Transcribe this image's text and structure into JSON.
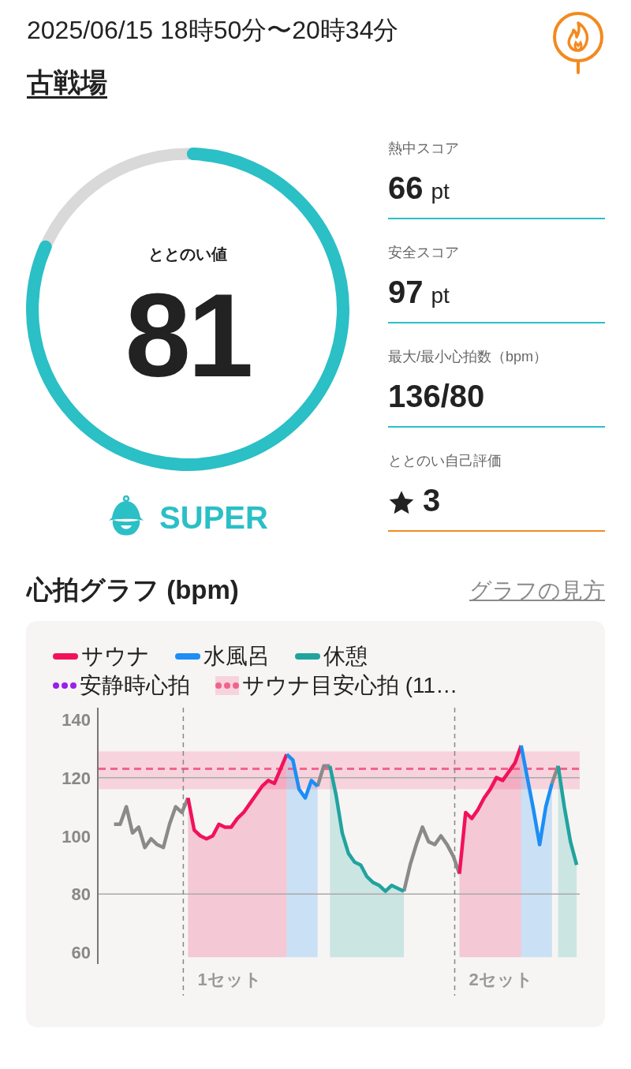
{
  "header": {
    "datetime": "2025/06/15 18時50分〜20時34分",
    "place": "古戦場"
  },
  "score": {
    "label": "ととのい値",
    "value": "81",
    "rank": "SUPER"
  },
  "stats": [
    {
      "label": "熱中スコア",
      "value": "66",
      "unit": "pt",
      "kind": "score",
      "color": "#2bbfc6"
    },
    {
      "label": "安全スコア",
      "value": "97",
      "unit": "pt",
      "kind": "score",
      "color": "#2bbfc6"
    },
    {
      "label": "最大/最小心拍数（bpm）",
      "value": "136/80",
      "kind": "plain",
      "color": "#2bbfc6"
    },
    {
      "label": "ととのい自己評価",
      "value": "3",
      "kind": "rating",
      "color": "#f28a20"
    }
  ],
  "graph": {
    "title": "心拍グラフ (bpm)",
    "help_link": "グラフの見方",
    "legend_extra": [
      {
        "label": "安静時心拍",
        "kind": "dots",
        "color": "#9b1fe8"
      },
      {
        "label": "サウナ目安心拍 (11…",
        "kind": "dots-band",
        "color": "#f0648c"
      }
    ],
    "sets": [
      {
        "label": "1セット"
      },
      {
        "label": "2セット"
      }
    ],
    "chart_data": {
      "type": "line",
      "ylim": [
        56,
        144
      ],
      "yticks": [
        60,
        80,
        100,
        120,
        140
      ],
      "grid": true,
      "ref_lines": [
        {
          "axis": "y",
          "value": 123,
          "color": "#f0648c"
        }
      ],
      "bands": [
        {
          "axis": "y",
          "from": 116,
          "to": 129,
          "color": "#f7d3dd"
        }
      ],
      "categories": [
        null,
        null,
        null,
        null,
        null,
        null,
        null,
        null,
        null,
        null,
        null,
        null,
        null,
        null,
        null,
        null,
        null,
        null,
        null,
        null,
        null,
        null,
        null,
        null,
        null,
        null,
        null,
        null,
        null,
        null,
        null,
        null,
        null,
        null,
        null,
        null,
        null,
        null,
        null,
        null,
        null,
        null,
        null,
        null,
        null,
        null,
        null,
        null,
        null,
        null,
        null,
        null,
        null,
        null,
        null,
        null,
        null,
        null,
        null,
        null,
        null,
        null,
        null,
        null,
        null,
        null,
        null,
        null,
        null,
        null,
        null,
        null,
        null,
        null,
        null,
        null,
        null,
        null
      ],
      "series": [
        {
          "color": "#8a8a8a",
          "values": [
            null,
            null,
            104,
            104,
            110,
            101,
            103,
            96,
            99,
            97,
            96,
            104,
            110,
            108,
            113,
            null,
            null,
            null,
            null,
            null,
            null,
            null,
            null,
            null,
            null,
            null,
            null,
            null,
            null,
            null,
            null,
            null,
            null,
            null,
            null,
            117,
            124,
            124,
            null,
            null,
            null,
            null,
            null,
            null,
            null,
            null,
            null,
            null,
            null,
            81,
            90,
            97,
            103,
            98,
            97,
            100,
            97,
            93,
            87,
            null,
            null,
            null,
            null,
            null,
            null,
            null,
            null,
            null,
            null,
            null,
            null,
            null,
            null,
            118,
            124,
            null,
            null,
            null
          ]
        },
        {
          "name": "サウナ",
          "color": "#f2125a",
          "values": [
            null,
            null,
            null,
            null,
            null,
            null,
            null,
            null,
            null,
            null,
            null,
            null,
            null,
            null,
            113,
            102,
            100,
            99,
            100,
            104,
            103,
            103,
            106,
            108,
            111,
            114,
            117,
            119,
            118,
            123,
            128,
            null,
            null,
            null,
            null,
            null,
            null,
            null,
            null,
            null,
            null,
            null,
            null,
            null,
            null,
            null,
            null,
            null,
            null,
            null,
            null,
            null,
            null,
            null,
            null,
            null,
            null,
            null,
            87,
            108,
            106,
            109,
            113,
            116,
            120,
            119,
            122,
            125,
            131,
            null,
            null,
            null,
            null,
            null,
            null,
            null,
            null,
            null
          ]
        },
        {
          "name": "水風呂",
          "color": "#1c8ef5",
          "values": [
            null,
            null,
            null,
            null,
            null,
            null,
            null,
            null,
            null,
            null,
            null,
            null,
            null,
            null,
            null,
            null,
            null,
            null,
            null,
            null,
            null,
            null,
            null,
            null,
            null,
            null,
            null,
            null,
            null,
            null,
            128,
            126,
            116,
            113,
            119,
            117,
            null,
            null,
            null,
            null,
            null,
            null,
            null,
            null,
            null,
            null,
            null,
            null,
            null,
            null,
            null,
            null,
            null,
            null,
            null,
            null,
            null,
            null,
            null,
            null,
            null,
            null,
            null,
            null,
            null,
            null,
            null,
            null,
            131,
            120,
            109,
            97,
            110,
            118,
            null,
            null,
            null,
            null
          ]
        },
        {
          "name": "休憩",
          "color": "#21a39f",
          "values": [
            null,
            null,
            null,
            null,
            null,
            null,
            null,
            null,
            null,
            null,
            null,
            null,
            null,
            null,
            null,
            null,
            null,
            null,
            null,
            null,
            null,
            null,
            null,
            null,
            null,
            null,
            null,
            null,
            null,
            null,
            null,
            null,
            null,
            null,
            null,
            null,
            null,
            124,
            114,
            101,
            94,
            91,
            90,
            86,
            84,
            83,
            81,
            83,
            82,
            81,
            null,
            null,
            null,
            null,
            null,
            null,
            null,
            null,
            null,
            null,
            null,
            null,
            null,
            null,
            null,
            null,
            null,
            null,
            null,
            null,
            null,
            null,
            null,
            null,
            124,
            110,
            98,
            90
          ]
        }
      ]
    }
  }
}
